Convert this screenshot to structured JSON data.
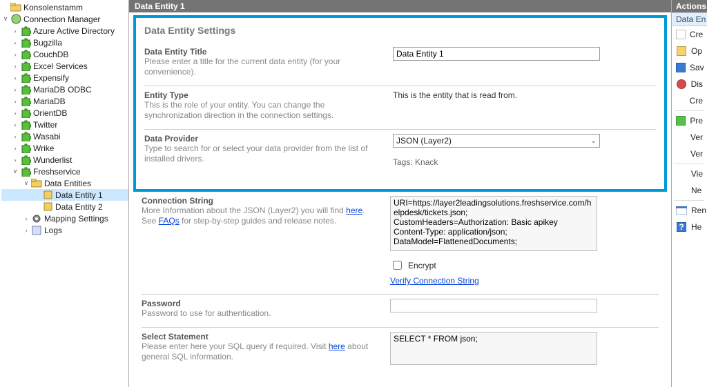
{
  "tree": {
    "root_label": "Konsolenstamm",
    "conn_mgr_label": "Connection Manager",
    "items": [
      "Azure Active Directory",
      "Bugzilla",
      "CouchDB",
      "Excel Services",
      "Expensify",
      "MariaDB ODBC",
      "MariaDB",
      "OrientDB",
      "Twitter",
      "Wasabi",
      "Wrike",
      "Wunderlist"
    ],
    "fresh_label": "Freshservice",
    "data_entities_label": "Data Entities",
    "data_entity_1_label": "Data Entity 1",
    "data_entity_2_label": "Data Entity 2",
    "mapping_label": "Mapping Settings",
    "logs_label": "Logs"
  },
  "header": {
    "title": "Data Entity 1"
  },
  "section": {
    "title": "Data Entity Settings",
    "title_label": "Data Entity Title",
    "title_desc": "Please enter a title for the current data entity (for your convenience).",
    "title_value": "Data Entity 1",
    "type_label": "Entity Type",
    "type_desc": "This is the role of your entity. You can change the synchronization direction in the connection settings.",
    "type_value": "This is the entity that is read from.",
    "provider_label": "Data Provider",
    "provider_desc": "Type to search for or select your data provider from the list of installed drivers.",
    "provider_value": "JSON (Layer2)",
    "provider_tags_label": "Tags: ",
    "provider_tags_value": "Knack"
  },
  "lower": {
    "conn_label": "Connection String",
    "conn_desc_prefix": "More Information about the JSON (Layer2) you will find ",
    "conn_here": "here",
    "conn_desc_mid": ". See ",
    "conn_faqs": "FAQs",
    "conn_desc_suffix": " for step-by-step guides and release notes.",
    "conn_value": "URI=https://layer2leadingsolutions.freshservice.com/helpdesk/tickets.json;\nCustomHeaders=Authorization: Basic apikey\nContent-Type: application/json;\nDataModel=FlattenedDocuments;",
    "encrypt_label": "Encrypt",
    "verify_link": "Verify Connection String",
    "pwd_label": "Password",
    "pwd_desc": "Password to use for authentication.",
    "sel_label": "Select Statement",
    "sel_desc_prefix": "Please enter here your SQL query if required. Visit ",
    "sel_here": "here",
    "sel_desc_suffix": " about general SQL information.",
    "sel_value": "SELECT * FROM json;"
  },
  "actions": {
    "header": "Actions",
    "subheader": "Data En",
    "items": [
      {
        "id": "create",
        "label": "Cre",
        "color": "white"
      },
      {
        "id": "open",
        "label": "Op",
        "color": "yellow"
      },
      {
        "id": "save",
        "label": "Sav",
        "color": "blue"
      },
      {
        "id": "discard",
        "label": "Dis",
        "color": "red"
      },
      {
        "id": "create2",
        "label": "Cre",
        "color": "none"
      },
      {
        "id": "preview",
        "label": "Pre",
        "color": "green"
      },
      {
        "id": "ver1",
        "label": "Ver",
        "color": "none"
      },
      {
        "id": "ver2",
        "label": "Ver",
        "color": "none"
      },
      {
        "id": "view",
        "label": "Vie",
        "color": "none"
      },
      {
        "id": "new",
        "label": "Ne",
        "color": "none"
      },
      {
        "id": "rename",
        "label": "Ren",
        "color": "window"
      },
      {
        "id": "help",
        "label": "He",
        "color": "help"
      }
    ]
  }
}
